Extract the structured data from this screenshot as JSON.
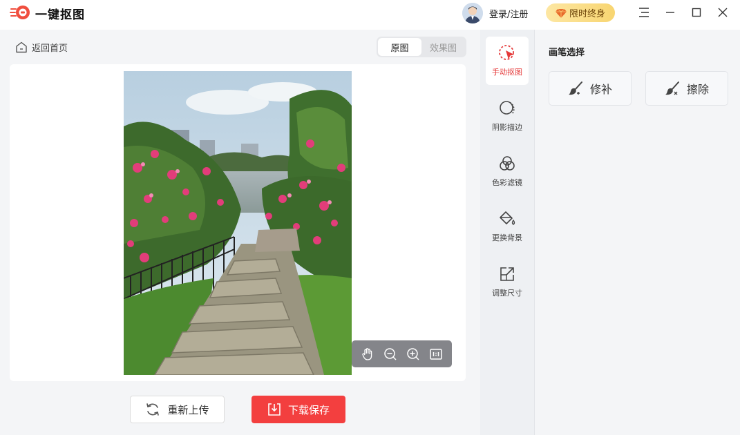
{
  "app": {
    "title": "一键抠图"
  },
  "header": {
    "login_label": "登录/注册",
    "vip_label": "限时终身"
  },
  "workspace": {
    "back_label": "返回首页",
    "view_toggle": {
      "original": "原图",
      "effect": "效果图",
      "active": "原图"
    },
    "reupload_label": "重新上传",
    "download_label": "下载保存"
  },
  "tools": [
    {
      "label": "手动抠图",
      "icon": "cursor-select-icon",
      "active": true
    },
    {
      "label": "阴影描边",
      "icon": "shadow-outline-icon",
      "active": false
    },
    {
      "label": "色彩滤镜",
      "icon": "color-filter-icon",
      "active": false
    },
    {
      "label": "更换背景",
      "icon": "paint-bucket-icon",
      "active": false
    },
    {
      "label": "调整尺寸",
      "icon": "resize-icon",
      "active": false
    }
  ],
  "panel": {
    "title": "画笔选择",
    "repair_label": "修补",
    "erase_label": "擦除"
  },
  "colors": {
    "accent": "#f33f3f",
    "vip_gold": "#f8d571",
    "rail_bg": "#eef0f3"
  }
}
